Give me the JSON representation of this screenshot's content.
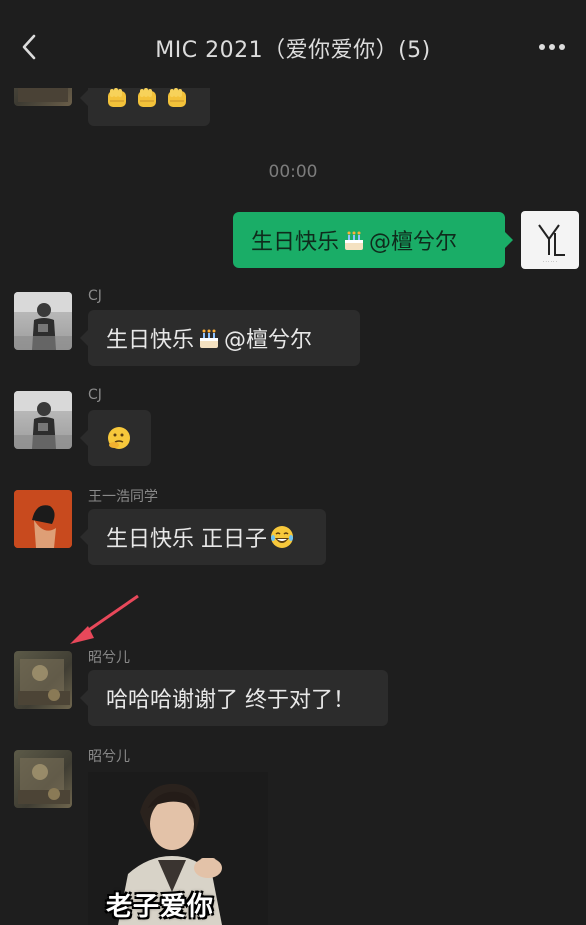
{
  "header": {
    "title": "MIC 2021（爱你爱你）(5)",
    "back_icon": "chevron-left-icon",
    "more_icon": "more-dots-icon"
  },
  "timestamp": "00:00",
  "messages": [
    {
      "sender": "",
      "from_me": false,
      "content_icons": [
        "raised-fist-emoji",
        "raised-fist-emoji",
        "raised-fist-emoji"
      ]
    },
    {
      "sender": "",
      "from_me": true,
      "text": "生日快乐",
      "emoji": "birthday-cake-emoji",
      "text_after": " @檀兮尔"
    },
    {
      "sender": "CJ",
      "from_me": false,
      "text": "生日快乐",
      "emoji": "birthday-cake-emoji",
      "text_after": " @檀兮尔"
    },
    {
      "sender": "CJ",
      "from_me": false,
      "content_icons": [
        "thinking-face-emoji"
      ]
    },
    {
      "sender": "王一浩同学",
      "from_me": false,
      "text": "生日快乐 正日子",
      "emoji": "laughing-tears-emoji",
      "text_after": ""
    },
    {
      "sender": "昭兮儿",
      "from_me": false,
      "text": "哈哈哈谢谢了 终于对了！"
    },
    {
      "sender": "昭兮儿",
      "from_me": false,
      "sticker_caption": "老子爱你"
    }
  ],
  "my_avatar_logo": "YL",
  "colors": {
    "background": "#1e1e1e",
    "bubble_other": "#2c2c2c",
    "bubble_me": "#1aad67",
    "annotation_arrow": "#e8485a"
  }
}
